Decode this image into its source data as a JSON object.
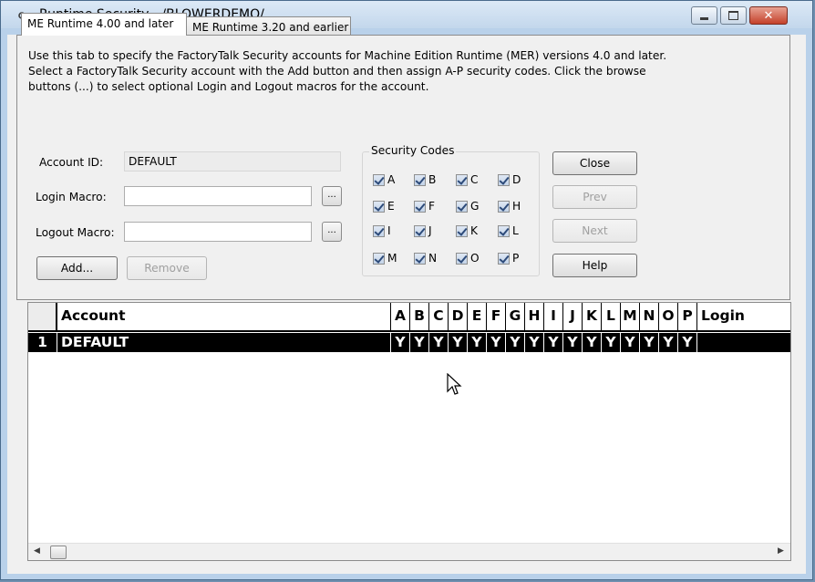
{
  "window": {
    "title": "Runtime Security - /BLOWERDEMO/",
    "icons": [
      "key-icon",
      "minimize-icon",
      "maximize-icon",
      "close-icon"
    ],
    "close_color": "#c4412a"
  },
  "tabs": [
    {
      "label": "ME Runtime 4.00 and later",
      "active": true
    },
    {
      "label": "ME Runtime 3.20 and earlier",
      "active": false
    }
  ],
  "description": [
    "Use this tab to specify the FactoryTalk Security accounts for Machine Edition Runtime (MER) versions 4.0 and later.",
    "Select a FactoryTalk Security account with the Add button and then assign A-P security codes.  Click the browse",
    "buttons (...) to select optional Login and Logout macros for the account."
  ],
  "form": {
    "account_id_label": "Account ID:",
    "account_id_value": "DEFAULT",
    "login_macro_label": "Login Macro:",
    "login_macro_value": "",
    "logout_macro_label": "Logout Macro:",
    "logout_macro_value": "",
    "browse_label": "...",
    "add_label": "Add...",
    "remove_label": "Remove"
  },
  "security_codes": {
    "title": "Security Codes",
    "codes": [
      {
        "label": "A",
        "checked": true
      },
      {
        "label": "B",
        "checked": true
      },
      {
        "label": "C",
        "checked": true
      },
      {
        "label": "D",
        "checked": true
      },
      {
        "label": "E",
        "checked": true
      },
      {
        "label": "F",
        "checked": true
      },
      {
        "label": "G",
        "checked": true
      },
      {
        "label": "H",
        "checked": true
      },
      {
        "label": "I",
        "checked": true
      },
      {
        "label": "J",
        "checked": true
      },
      {
        "label": "K",
        "checked": true
      },
      {
        "label": "L",
        "checked": true
      },
      {
        "label": "M",
        "checked": true
      },
      {
        "label": "N",
        "checked": true
      },
      {
        "label": "O",
        "checked": true
      },
      {
        "label": "P",
        "checked": true
      }
    ]
  },
  "side_buttons": {
    "close": "Close",
    "prev": "Prev",
    "next": "Next",
    "help": "Help"
  },
  "grid": {
    "columns": [
      "Account",
      "A",
      "B",
      "C",
      "D",
      "E",
      "F",
      "G",
      "H",
      "I",
      "J",
      "K",
      "L",
      "M",
      "N",
      "O",
      "P",
      "Login"
    ],
    "rows": [
      {
        "num": "1",
        "account": "DEFAULT",
        "codes": [
          "Y",
          "Y",
          "Y",
          "Y",
          "Y",
          "Y",
          "Y",
          "Y",
          "Y",
          "Y",
          "Y",
          "Y",
          "Y",
          "Y",
          "Y",
          "Y"
        ],
        "login": ""
      }
    ]
  }
}
